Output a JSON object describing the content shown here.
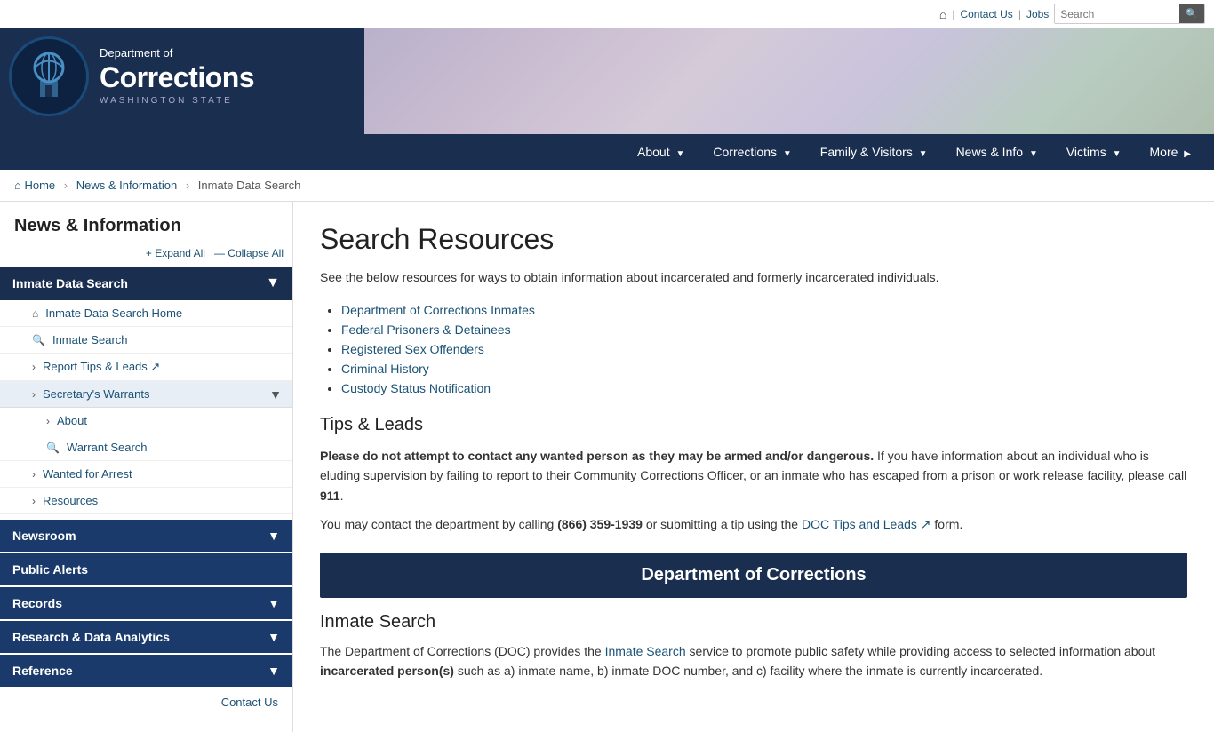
{
  "topbar": {
    "home_icon": "⌂",
    "contact_us": "Contact Us",
    "jobs": "Jobs",
    "search_placeholder": "Search",
    "search_btn": "🔍"
  },
  "header": {
    "dept_line1": "Department of",
    "dept_line2": "Corrections",
    "dept_line3": "WASHINGTON STATE"
  },
  "nav": {
    "items": [
      {
        "label": "About",
        "has_arrow": true
      },
      {
        "label": "Corrections",
        "has_arrow": true
      },
      {
        "label": "Family & Visitors",
        "has_arrow": true
      },
      {
        "label": "News & Info",
        "has_arrow": true
      },
      {
        "label": "Victims",
        "has_arrow": true
      },
      {
        "label": "More",
        "has_arrow": true
      }
    ]
  },
  "breadcrumb": {
    "home": "Home",
    "sep1": "›",
    "news": "News & Information",
    "sep2": "›",
    "current": "Inmate Data Search"
  },
  "sidebar": {
    "title": "News & Information",
    "expand_all": "+ Expand All",
    "collapse_all": "— Collapse All",
    "sections": [
      {
        "type": "header",
        "label": "Inmate Data Search",
        "has_chevron": true
      },
      {
        "type": "item",
        "icon": "⌂",
        "label": "Inmate Data Search Home",
        "indent": 1
      },
      {
        "type": "item",
        "icon": "🔍",
        "label": "Inmate Search",
        "indent": 1
      },
      {
        "type": "item",
        "icon": "›",
        "label": "Report Tips & Leads ↗",
        "indent": 1
      },
      {
        "type": "subheader",
        "icon": "›",
        "label": "Secretary's Warrants",
        "has_chevron": true,
        "indent": 1
      },
      {
        "type": "item",
        "icon": "›",
        "label": "About",
        "indent": 2
      },
      {
        "type": "item",
        "icon": "🔍",
        "label": "Warrant Search",
        "indent": 2
      },
      {
        "type": "item",
        "icon": "›",
        "label": "Wanted for Arrest",
        "indent": 1
      },
      {
        "type": "item",
        "icon": "›",
        "label": "Resources",
        "indent": 1
      }
    ],
    "bottom_sections": [
      {
        "label": "Newsroom",
        "has_chevron": true
      },
      {
        "label": "Public Alerts",
        "has_chevron": false
      },
      {
        "label": "Records",
        "has_chevron": true
      },
      {
        "label": "Research & Data Analytics",
        "has_chevron": true
      },
      {
        "label": "Reference",
        "has_chevron": true
      }
    ],
    "contact_us": "Contact Us"
  },
  "main": {
    "page_title": "Search Resources",
    "intro": "See the below resources for ways to obtain information about incarcerated and formerly incarcerated individuals.",
    "resource_links": [
      "Department of Corrections Inmates",
      "Federal Prisoners & Detainees",
      "Registered Sex Offenders",
      "Criminal History",
      "Custody Status Notification"
    ],
    "tips_heading": "Tips & Leads",
    "tips_bold": "Please do not attempt to contact any wanted person as they may be armed and/or dangerous.",
    "tips_body": " If you have information about an individual who is eluding supervision by failing to report to their Community Corrections Officer, or an inmate who has escaped from a prison or work release facility, please call ",
    "tips_911": "911",
    "tips_body2": ".",
    "tips_line2_pre": "You may contact the department by calling ",
    "tips_phone": "(866) 359-1939",
    "tips_line2_mid": " or submitting a tip using the ",
    "tips_link": "DOC Tips and Leads ↗",
    "tips_line2_post": " form.",
    "doc_banner": "Department of Corrections",
    "inmate_search_title": "Inmate Search",
    "inmate_search_pre": "The Department of Corrections (DOC) provides the ",
    "inmate_search_link": "Inmate Search",
    "inmate_search_mid": " service to promote public safety while providing access to selected information about ",
    "inmate_search_bold": "incarcerated person(s)",
    "inmate_search_post": " such as a) inmate name, b) inmate DOC number, and c) facility where the inmate is currently incarcerated."
  }
}
